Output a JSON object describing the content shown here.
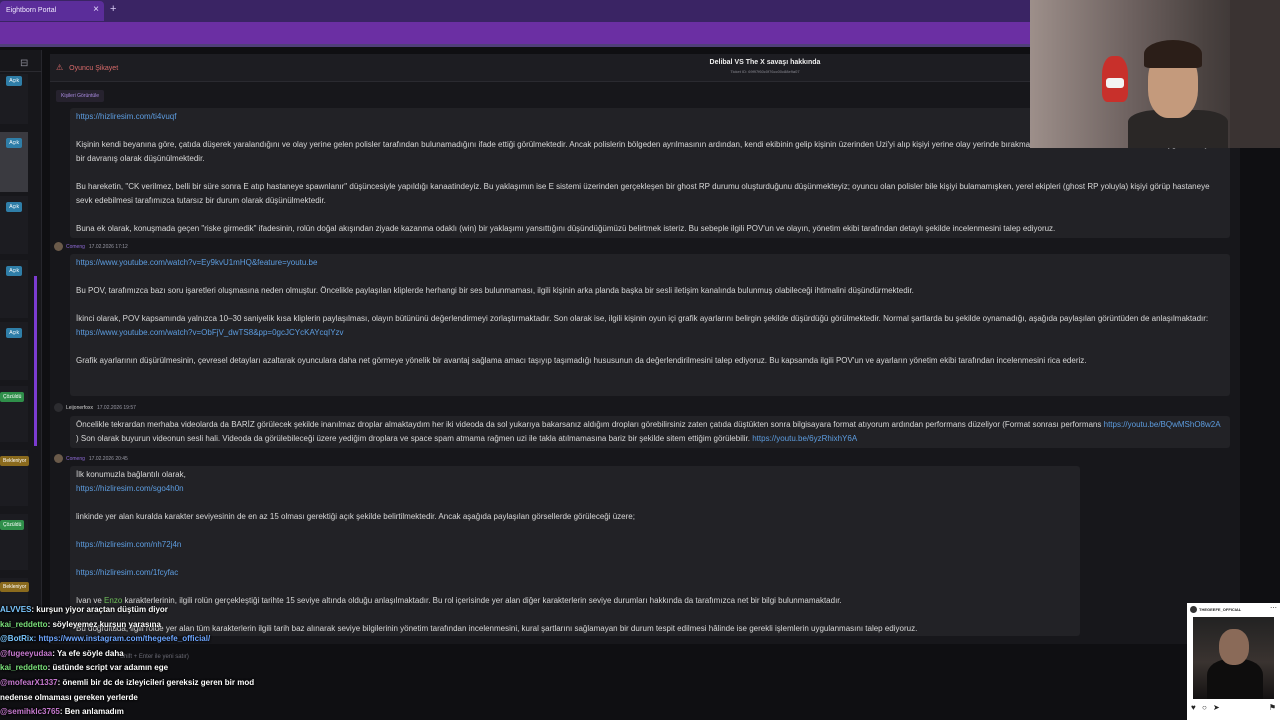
{
  "browser": {
    "tab_title": "Eightborn Portal",
    "tab_close": "×",
    "new_tab": "+"
  },
  "sidebar": {
    "badges": [
      {
        "label": "Açık",
        "kind": "acik"
      },
      {
        "label": "Açık",
        "kind": "acik"
      },
      {
        "label": "Açık",
        "kind": "acik"
      },
      {
        "label": "Açık",
        "kind": "acik"
      },
      {
        "label": "Açık",
        "kind": "acik"
      },
      {
        "label": "Çözüldü",
        "kind": "coz"
      },
      {
        "label": "Bekleniyor",
        "kind": "bek"
      },
      {
        "label": "Çözüldü",
        "kind": "coz"
      },
      {
        "label": "Bekleniyor",
        "kind": "bek"
      }
    ]
  },
  "ticket": {
    "category": "Oyuncu Şikayet",
    "title": "Delibal VS The X savaşı hakkında",
    "ticket_id": "Ticket ID: 69f97f60c0f76cc00c88e9a07",
    "attachments_label": "Kişileri Görüntüle"
  },
  "messages": [
    {
      "author": "",
      "time": "",
      "paragraphs": [
        {
          "link": "https://hizliresim.com/ti4vuqf"
        },
        {
          "text": "Kişinin kendi beyanına göre, çatıda düşerek yaralandığını ve olay yerine gelen polisler tarafından bulunamadığını ifade ettiği görülmektedir. Ancak polislerin bölgeden ayrılmasının ardından, kendi ekibinin gelip kişinin üzerinden Uzi'yi alıp kişiyi yerine olay yerinde bırakması, tarafımızca hard RP mentalitesine uygun olmayan bir davranış olarak düşünülmektedir."
        },
        {
          "text": "Bu hareketin, \"CK verilmez, belli bir süre sonra E atıp hastaneye spawnlanır\" düşüncesiyle yapıldığı kanaatindeyiz. Bu yaklaşımın ise E sistemi üzerinden gerçekleşen bir ghost RP durumu oluşturduğunu düşünmekteyiz; oyuncu olan polisler bile kişiyi bulamamışken, yerel ekipleri (ghost RP yoluyla) kişiyi görüp hastaneye sevk edebilmesi tarafımızca tutarsız bir durum olarak düşünülmektedir."
        },
        {
          "text": "Buna ek olarak, konuşmada geçen \"riske girmedik\" ifadesinin, rolün doğal akışından ziyade kazanma odaklı (win) bir yaklaşımı yansıttığını düşündüğümüzü belirtmek isteriz. Bu sebeple ilgili POV'un ve olayın, yönetim ekibi tarafından detaylı şekilde incelenmesini talep ediyoruz."
        }
      ]
    },
    {
      "author": "Comeng",
      "time": "17.02.2026 17:12",
      "paragraphs": [
        {
          "link": "https://www.youtube.com/watch?v=Ey9kvU1mHQ&feature=youtu.be"
        },
        {
          "text": "Bu POV, tarafımızca bazı soru işaretleri oluşmasına neden olmuştur. Öncelikle paylaşılan kliplerde herhangi bir ses bulunmaması, ilgili kişinin arka planda başka bir sesli iletişim kanalında bulunmuş olabileceği ihtimalini düşündürmektedir."
        },
        {
          "text": "İkinci olarak, POV kapsamında yalnızca 10–30 saniyelik kısa kliplerin paylaşılması, olayın bütününü değerlendirmeyi zorlaştırmaktadır. Son olarak ise, ilgili kişinin oyun içi grafik ayarlarını belirgin şekilde düşürdüğü görülmektedir. Normal şartlarda bu şekilde oynamadığı, aşağıda paylaşılan görüntüden de anlaşılmaktadır:"
        },
        {
          "link": "https://www.youtube.com/watch?v=ObFjV_dwTS8&pp=0gcJCYcKAYcqIYzv"
        },
        {
          "text": "Grafik ayarlarının düşürülmesinin, çevresel detayları azaltarak oyunculara daha net görmeye yönelik bir avantaj sağlama amacı taşıyıp taşımadığı hususunun da değerlendirilmesini talep ediyoruz. Bu kapsamda ilgili POV'un ve ayarların yönetim ekibi tarafından incelenmesini rica ederiz."
        }
      ]
    },
    {
      "author": "Leijonerfoxx",
      "time": "17.02.2026 19:57",
      "p1": "Öncelikle tekrardan merhaba videolarda da BARİZ görülecek şekilde inanılmaz droplar almaktaydım her iki videoda da sol yukarıya bakarsanız aldığım dropları görebilirsiniz zaten çatıda düştükten sonra bilgisayara format atıyorum ardından performans düzeliyor (Format sonrası performans",
      "link1": "https://youtu.be/BQwMShO8w2A",
      "p2": ") Son olarak buyurun videonun sesli hali. Videoda da görülebileceği üzere yediğim droplara ve space spam atmama rağmen uzi ile takla atılmamasına bariz bir şekilde sitem ettiğim görülebilir.",
      "link2": "https://youtu.be/6yzRhixhY6A"
    },
    {
      "author": "Comeng",
      "time": "17.02.2026 20:45",
      "intro": "İlk konumuzla bağlantılı olarak,",
      "link_a": "https://hizliresim.com/sgo4h0n",
      "text_b": "linkinde yer alan kuralda karakter seviyesinin de en az 15 olması gerektiği açık şekilde belirtilmektedir. Ancak aşağıda paylaşılan görsellerde görüleceği üzere;",
      "link_c": "https://hizliresim.com/nh72j4n",
      "link_d": "https://hizliresim.com/1fcyfac",
      "text_e1": "Ivan ve",
      "text_e_hl": "Enzo",
      "text_e2": "karakterlerinin, ilgili rolün gerçekleştiği tarihte 15 seviye altında olduğu anlaşılmaktadır. Bu rol içerisinde yer alan diğer karakterlerin seviye durumları hakkında da tarafımızca net bir bilgi bulunmamaktadır.",
      "text_f": "Bu doğrultuda, ilgili rolde yer alan tüm karakterlerin ilgili tarih baz alınarak seviye bilgilerinin yönetim tarafından incelenmesini, kural şartlarını sağlamayan bir durum tespit edilmesi hâlinde ise gerekli işlemlerin uygulanmasını talep ediyoruz."
    }
  ],
  "reply_placeholder": "Shift + Enter ile yeni satır)",
  "chat": [
    {
      "user": "ALVVES",
      "color": "blue",
      "text": ": kurşun yiyor araçtan düştüm diyor"
    },
    {
      "user": "kai_reddetto",
      "color": "green",
      "text": ": söyleyemez kurşun yarasına"
    },
    {
      "user": "@BotRix",
      "color": "blue",
      "text": ": https://www.instagram.com/thegeefe_official/",
      "is_link": true
    },
    {
      "user": "@fugeeyudaa",
      "color": "pink",
      "text": ": Ya efe söyle daha"
    },
    {
      "user": "kai_reddetto",
      "color": "green",
      "text": ": üstünde script var adamın ege"
    },
    {
      "user": "@mofearX1337",
      "color": "pink",
      "text": ": önemli bir dc de izleyicileri gereksiz geren bir mod"
    },
    {
      "user": "",
      "color": "white",
      "text": "nedense olmaması gereken yerlerde"
    },
    {
      "user": "@semihklc3765",
      "color": "pink",
      "text": ": Ben anlamadım"
    }
  ],
  "instagram": {
    "handle": "THEGEEFE_OFFICIAL",
    "more": "⋯",
    "actions": "♥ ○ ➤",
    "save": "⚑"
  },
  "icons": {
    "collapse": "⊟",
    "report": "⚠"
  }
}
